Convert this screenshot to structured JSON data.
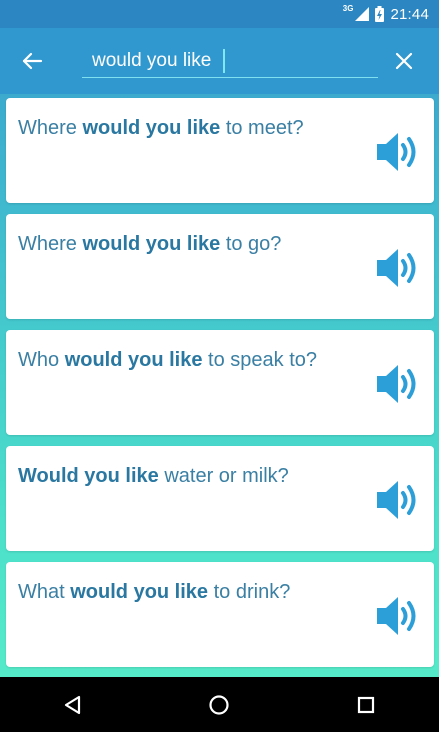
{
  "status_bar": {
    "network": "3G",
    "time": "21:44"
  },
  "app_bar": {
    "back_icon": "arrow-left-icon",
    "search": {
      "value": "would you like",
      "placeholder": ""
    },
    "clear_icon": "close-icon"
  },
  "phrases": [
    {
      "before": "Where ",
      "highlight": "would you like",
      "after": " to meet?",
      "icon": "speaker-icon"
    },
    {
      "before": "Where ",
      "highlight": "would you like",
      "after": " to go?",
      "icon": "speaker-icon"
    },
    {
      "before": "Who ",
      "highlight": "would you like",
      "after": " to speak to?",
      "icon": "speaker-icon"
    },
    {
      "before": "",
      "highlight": "Would you like",
      "after": " water or milk?",
      "icon": "speaker-icon"
    },
    {
      "before": "What ",
      "highlight": "would you like",
      "after": " to drink?",
      "icon": "speaker-icon"
    }
  ],
  "nav_bar": {
    "back_icon": "triangle-back-icon",
    "home_icon": "circle-home-icon",
    "recents_icon": "square-recents-icon"
  },
  "colors": {
    "status_bar": "#2b86c1",
    "app_bar": "#3198cf",
    "accent": "#2d9fd8",
    "phrase_text": "#3a7fa4",
    "gradient_bottom": "#55ebc9"
  }
}
